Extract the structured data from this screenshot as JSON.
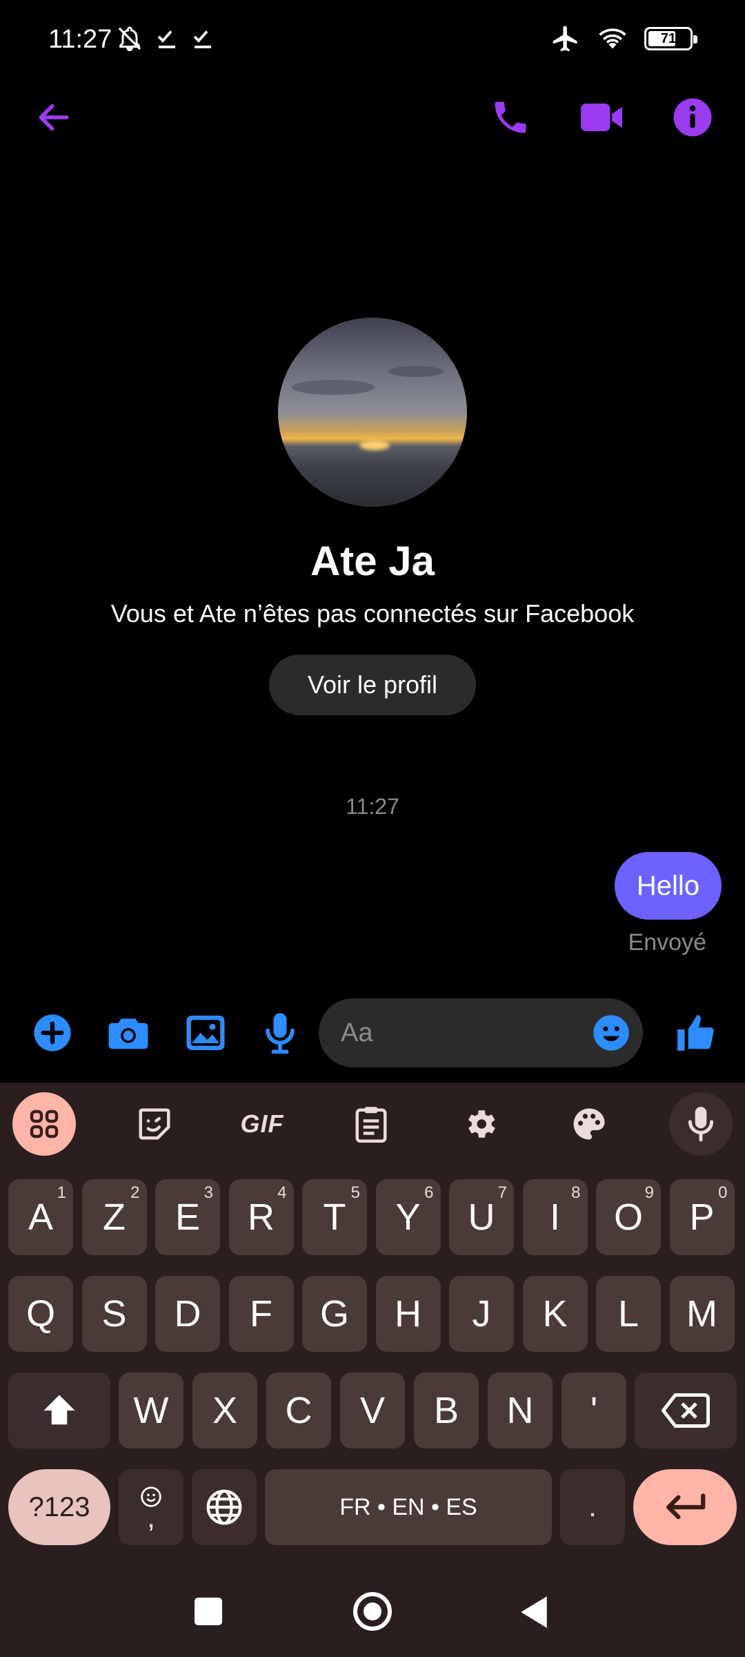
{
  "status_bar": {
    "time": "11:27",
    "battery": "71",
    "battery_level": 0.71
  },
  "header": {
    "icons": [
      "back-arrow-icon",
      "phone-icon",
      "video-camera-icon",
      "info-icon"
    ],
    "accent_color": "#9b3cf0"
  },
  "profile": {
    "name": "Ate Ja",
    "subtitle": "Vous et Ate n’êtes pas connectés sur Facebook",
    "view_profile_label": "Voir le profil"
  },
  "messages": {
    "timestamp": "11:27",
    "items": [
      {
        "text": "Hello",
        "sender": "me",
        "status": "Envoyé"
      }
    ],
    "bubble_color": "#6c63ff"
  },
  "composer": {
    "placeholder": "Aa",
    "icons": [
      "plus-icon",
      "camera-icon",
      "gallery-icon",
      "microphone-icon",
      "emoji-icon",
      "thumbs-up-icon"
    ],
    "icon_color": "#2d8cff"
  },
  "keyboard": {
    "toolbar": [
      "apps-grid-icon",
      "sticker-icon",
      "gif-icon",
      "clipboard-icon",
      "settings-gear-icon",
      "palette-icon",
      "microphone-icon"
    ],
    "gif_label": "GIF",
    "row1": [
      {
        "k": "A",
        "s": "1"
      },
      {
        "k": "Z",
        "s": "2"
      },
      {
        "k": "E",
        "s": "3"
      },
      {
        "k": "R",
        "s": "4"
      },
      {
        "k": "T",
        "s": "5"
      },
      {
        "k": "Y",
        "s": "6"
      },
      {
        "k": "U",
        "s": "7"
      },
      {
        "k": "I",
        "s": "8"
      },
      {
        "k": "O",
        "s": "9"
      },
      {
        "k": "P",
        "s": "0"
      }
    ],
    "row2": [
      "Q",
      "S",
      "D",
      "F",
      "G",
      "H",
      "J",
      "K",
      "L",
      "M"
    ],
    "row3": [
      "W",
      "X",
      "C",
      "V",
      "B",
      "N",
      "'"
    ],
    "symbols_label": "?123",
    "comma_label": ",",
    "space_label": "FR • EN • ES",
    "period_label": ".",
    "accent_key_color": "#ffb4a8"
  },
  "nav_bar": {
    "icons": [
      "recents-square-icon",
      "home-circle-icon",
      "back-triangle-icon"
    ]
  }
}
